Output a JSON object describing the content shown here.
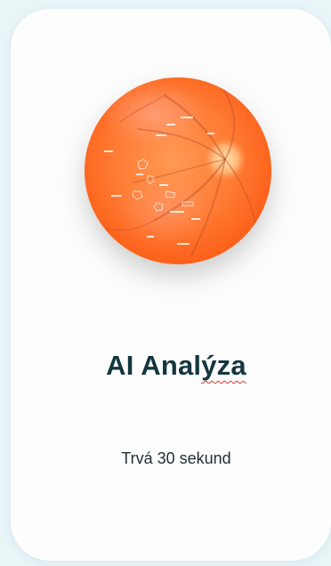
{
  "card": {
    "title_start": "AI Anal",
    "title_flagged": "ýza",
    "subtitle": "Trvá 30 sekund"
  },
  "retina_image": {
    "icon": "retina-fundus-image",
    "colors": {
      "outer": "#ff6a1f",
      "inner": "#ff9650",
      "optic_disc": "#ffd9a0",
      "vessels": "#c2502c"
    }
  }
}
